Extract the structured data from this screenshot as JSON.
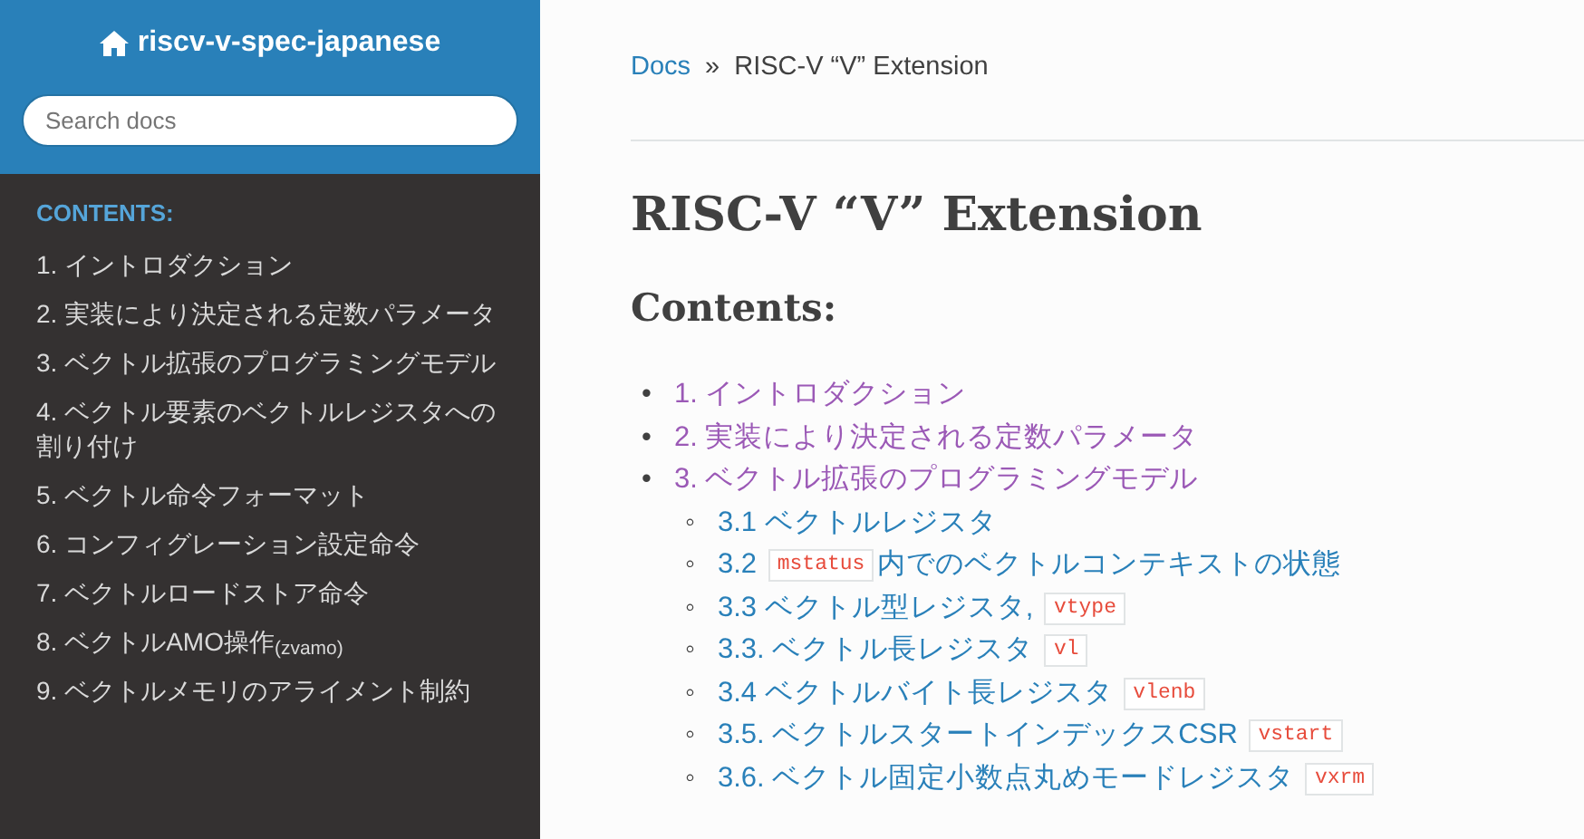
{
  "sidebar": {
    "project_title": "riscv-v-spec-japanese",
    "search": {
      "placeholder": "Search docs"
    },
    "caption": "CONTENTS:",
    "items": [
      {
        "label": "1. イントロダクション"
      },
      {
        "label": "2. 実装により決定される定数パラメータ"
      },
      {
        "label": "3. ベクトル拡張のプログラミングモデル"
      },
      {
        "label": "4. ベクトル要素のベクトルレジスタへの割り付け"
      },
      {
        "label": "5. ベクトル命令フォーマット"
      },
      {
        "label": "6. コンフィグレーション設定命令"
      },
      {
        "label": "7. ベクトルロードストア命令"
      },
      {
        "label": "8. ベクトルAMO操作$_{(zvamo)}$"
      },
      {
        "label": "9. ベクトルメモリのアライメント制約"
      }
    ]
  },
  "breadcrumb": {
    "link": "Docs",
    "separator": "»",
    "current": "RISC-V “V” Extension"
  },
  "page_title": "RISC-V “V” Extension",
  "contents_heading": "Contents:",
  "toc": [
    {
      "bullet": "•",
      "text_before": "1. イントロダクション",
      "visited": true
    },
    {
      "bullet": "•",
      "text_before": "2. 実装により決定される定数パラメータ",
      "visited": true
    },
    {
      "bullet": "•",
      "text_before": "3. ベクトル拡張のプログラミングモデル",
      "visited": true,
      "children": [
        {
          "bullet": "◦",
          "text_before": "3.1 ベクトルレジスタ",
          "visited": false
        },
        {
          "bullet": "◦",
          "text_before": "3.2",
          "code": "mstatus",
          "text_after": "内でのベクトルコンテキストの状態",
          "visited": false
        },
        {
          "bullet": "◦",
          "text_before": "3.3 ベクトル型レジスタ,",
          "code": "vtype",
          "visited": false
        },
        {
          "bullet": "◦",
          "text_before": "3.3. ベクトル長レジスタ",
          "code": "vl",
          "visited": false
        },
        {
          "bullet": "◦",
          "text_before": "3.4 ベクトルバイト長レジスタ",
          "code": "vlenb",
          "visited": false
        },
        {
          "bullet": "◦",
          "text_before": "3.5. ベクトルスタートインデックスCSR",
          "code": "vstart",
          "visited": false
        },
        {
          "bullet": "◦",
          "text_before": "3.6. ベクトル固定小数点丸めモードレジスタ",
          "code": "vxrm",
          "visited": false
        }
      ]
    }
  ]
}
